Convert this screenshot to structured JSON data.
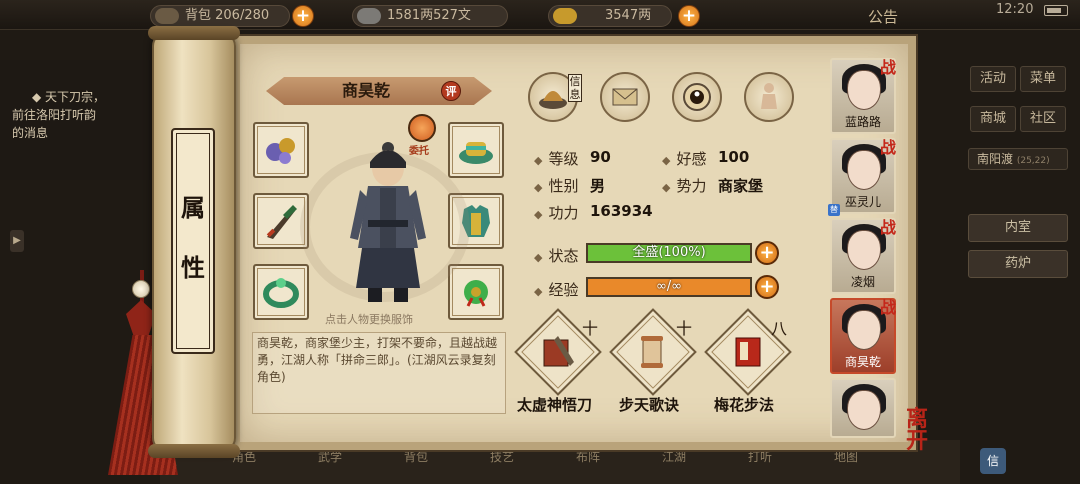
{
  "topbar": {
    "bag": "背包 206/280",
    "money": "1581两527文",
    "gold": "3547两",
    "notice": "公告",
    "time": "12:20"
  },
  "quest": {
    "title": "天下刀宗，",
    "line1": "前往洛阳打听韵",
    "line2": "的消息"
  },
  "right_menu": {
    "activity": "活动",
    "menu": "菜单",
    "mall": "商城",
    "community": "社区",
    "location": "南阳渡",
    "coords": "(25,22)",
    "room_inner": "内室",
    "room_furnace": "药炉"
  },
  "bottom_menu": [
    "角色",
    "武学",
    "背包",
    "技艺",
    "布阵",
    "江湖",
    "打听",
    "地图"
  ],
  "scroll": {
    "title": "属性"
  },
  "character": {
    "name": "商昊乾",
    "rate_badge": "评",
    "delegate": "委托",
    "hint": "点击人物更换服饰",
    "description": "商昊乾，商家堡少主，打架不要命，且越战越勇，江湖人称「拼命三郎」。(江湖风云录复刻角色)"
  },
  "tabs": {
    "info_label": "信息"
  },
  "stats": {
    "level_label": "等级",
    "level": "90",
    "favor_label": "好感",
    "favor": "100",
    "gender_label": "性别",
    "gender": "男",
    "faction_label": "势力",
    "faction": "商家堡",
    "power_label": "功力",
    "power": "163934"
  },
  "status": {
    "label": "状态",
    "text": "全盛(100%)",
    "fill": 1.0,
    "color": "#6cc13a"
  },
  "exp": {
    "label": "经验",
    "text": "∞/∞",
    "fill": 1.0,
    "color": "#e9892a"
  },
  "skills": [
    {
      "name": "太虚神悟刀",
      "level": "十"
    },
    {
      "name": "步天歌诀",
      "level": "十"
    },
    {
      "name": "梅花步法",
      "level": "八"
    }
  ],
  "roster": [
    {
      "name": "蓝路路",
      "tag": "战"
    },
    {
      "name": "巫灵儿",
      "tag": "战"
    },
    {
      "name": "凌烟",
      "tag": "战"
    },
    {
      "name": "商昊乾",
      "tag": "战"
    },
    {
      "name": "",
      "tag": ""
    }
  ],
  "swap_tag": "替",
  "leave": "离开",
  "colors": {
    "parchment": "#e6d8b7",
    "accent_red": "#b82418",
    "status_green": "#6cc13a",
    "exp_orange": "#e9892a"
  }
}
